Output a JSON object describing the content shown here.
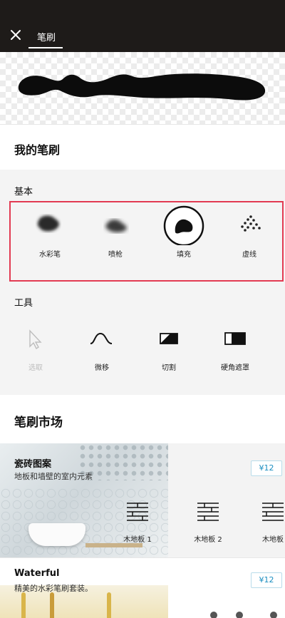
{
  "header": {
    "title": "笔刷",
    "close_icon": "close-icon"
  },
  "my_brushes": {
    "title": "我的笔刷"
  },
  "basic": {
    "title": "基本",
    "items": [
      {
        "label": "水彩笔",
        "icon": "watercolor-brush-icon"
      },
      {
        "label": "喷枪",
        "icon": "airbrush-icon"
      },
      {
        "label": "填充",
        "icon": "fill-icon",
        "selected": true
      },
      {
        "label": "虚线",
        "icon": "dotted-line-icon"
      }
    ]
  },
  "tools": {
    "title": "工具",
    "items": [
      {
        "label": "选取",
        "icon": "cursor-icon",
        "disabled": true
      },
      {
        "label": "微移",
        "icon": "wave-icon"
      },
      {
        "label": "切割",
        "icon": "cut-icon"
      },
      {
        "label": "硬角遮罩",
        "icon": "hard-mask-icon"
      }
    ]
  },
  "market": {
    "title": "笔刷市场",
    "packs": [
      {
        "name": "瓷砖图案",
        "desc": "地板和墙壁的室内元素",
        "price": "¥12",
        "items": [
          "木地板 1",
          "木地板 2",
          "木地板"
        ]
      },
      {
        "name": "Waterful",
        "desc": "精美的水彩笔刷套装。",
        "price": "¥12"
      }
    ]
  },
  "colors": {
    "header_bg": "#1e1b19",
    "highlight": "#e23a52",
    "price_text": "#1b8ec0"
  }
}
